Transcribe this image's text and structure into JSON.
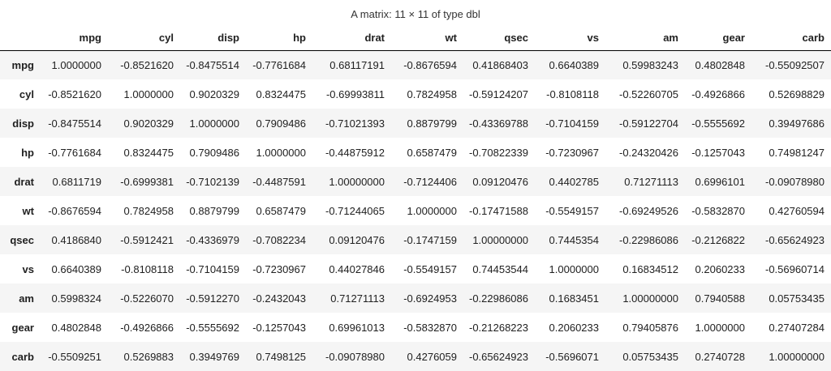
{
  "caption": "A matrix: 11 × 11 of type dbl",
  "columns": [
    "mpg",
    "cyl",
    "disp",
    "hp",
    "drat",
    "wt",
    "qsec",
    "vs",
    "am",
    "gear",
    "carb"
  ],
  "rows": [
    {
      "name": "mpg",
      "values": [
        "1.0000000",
        "-0.8521620",
        "-0.8475514",
        "-0.7761684",
        "0.68117191",
        "-0.8676594",
        "0.41868403",
        "0.6640389",
        "0.59983243",
        "0.4802848",
        "-0.55092507"
      ]
    },
    {
      "name": "cyl",
      "values": [
        "-0.8521620",
        "1.0000000",
        "0.9020329",
        "0.8324475",
        "-0.69993811",
        "0.7824958",
        "-0.59124207",
        "-0.8108118",
        "-0.52260705",
        "-0.4926866",
        "0.52698829"
      ]
    },
    {
      "name": "disp",
      "values": [
        "-0.8475514",
        "0.9020329",
        "1.0000000",
        "0.7909486",
        "-0.71021393",
        "0.8879799",
        "-0.43369788",
        "-0.7104159",
        "-0.59122704",
        "-0.5555692",
        "0.39497686"
      ]
    },
    {
      "name": "hp",
      "values": [
        "-0.7761684",
        "0.8324475",
        "0.7909486",
        "1.0000000",
        "-0.44875912",
        "0.6587479",
        "-0.70822339",
        "-0.7230967",
        "-0.24320426",
        "-0.1257043",
        "0.74981247"
      ]
    },
    {
      "name": "drat",
      "values": [
        "0.6811719",
        "-0.6999381",
        "-0.7102139",
        "-0.4487591",
        "1.00000000",
        "-0.7124406",
        "0.09120476",
        "0.4402785",
        "0.71271113",
        "0.6996101",
        "-0.09078980"
      ]
    },
    {
      "name": "wt",
      "values": [
        "-0.8676594",
        "0.7824958",
        "0.8879799",
        "0.6587479",
        "-0.71244065",
        "1.0000000",
        "-0.17471588",
        "-0.5549157",
        "-0.69249526",
        "-0.5832870",
        "0.42760594"
      ]
    },
    {
      "name": "qsec",
      "values": [
        "0.4186840",
        "-0.5912421",
        "-0.4336979",
        "-0.7082234",
        "0.09120476",
        "-0.1747159",
        "1.00000000",
        "0.7445354",
        "-0.22986086",
        "-0.2126822",
        "-0.65624923"
      ]
    },
    {
      "name": "vs",
      "values": [
        "0.6640389",
        "-0.8108118",
        "-0.7104159",
        "-0.7230967",
        "0.44027846",
        "-0.5549157",
        "0.74453544",
        "1.0000000",
        "0.16834512",
        "0.2060233",
        "-0.56960714"
      ]
    },
    {
      "name": "am",
      "values": [
        "0.5998324",
        "-0.5226070",
        "-0.5912270",
        "-0.2432043",
        "0.71271113",
        "-0.6924953",
        "-0.22986086",
        "0.1683451",
        "1.00000000",
        "0.7940588",
        "0.05753435"
      ]
    },
    {
      "name": "gear",
      "values": [
        "0.4802848",
        "-0.4926866",
        "-0.5555692",
        "-0.1257043",
        "0.69961013",
        "-0.5832870",
        "-0.21268223",
        "0.2060233",
        "0.79405876",
        "1.0000000",
        "0.27407284"
      ]
    },
    {
      "name": "carb",
      "values": [
        "-0.5509251",
        "0.5269883",
        "0.3949769",
        "0.7498125",
        "-0.09078980",
        "0.4276059",
        "-0.65624923",
        "-0.5696071",
        "0.05753435",
        "0.2740728",
        "1.00000000"
      ]
    }
  ]
}
